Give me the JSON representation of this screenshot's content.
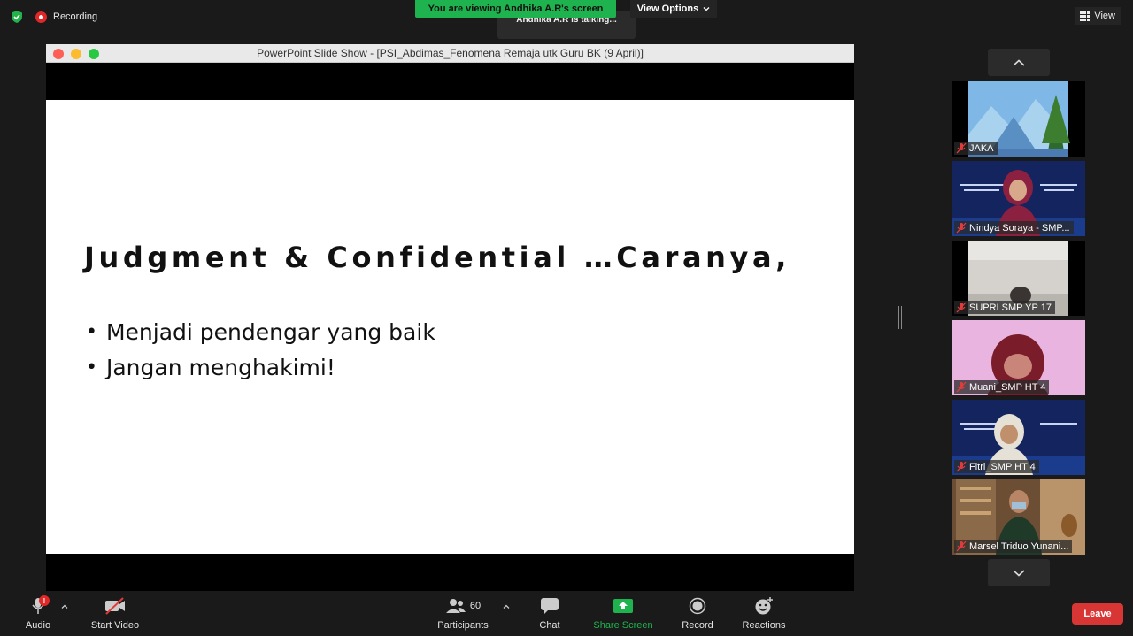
{
  "header": {
    "recording_label": "Recording",
    "viewing_banner": "You are viewing Andhika A.R's screen",
    "talking_indicator": "Andhika A.R is talking...",
    "view_options_label": "View Options",
    "view_label": "View"
  },
  "shared_window": {
    "title": "PowerPoint Slide Show  -  [PSI_Abdimas_Fenomena Remaja utk Guru BK (9 April)]",
    "slide": {
      "title": "Judgment & Confidential …Caranya,",
      "bullets": [
        "Menjadi pendengar yang baik",
        "Jangan menghakimi!"
      ]
    }
  },
  "gallery": {
    "participants": [
      {
        "name": "JAKA",
        "muted": true
      },
      {
        "name": "Nindya Soraya - SMP...",
        "muted": true
      },
      {
        "name": "SUPRI SMP YP 17",
        "muted": true
      },
      {
        "name": "Muani_SMP HT 4",
        "muted": true
      },
      {
        "name": "Fitri_SMP HT 4",
        "muted": true
      },
      {
        "name": "Marsel Triduo Yunani...",
        "muted": true
      }
    ]
  },
  "toolbar": {
    "audio_label": "Audio",
    "audio_badge": "!",
    "video_label": "Start Video",
    "participants_label": "Participants",
    "participants_count": "60",
    "chat_label": "Chat",
    "share_label": "Share Screen",
    "record_label": "Record",
    "reactions_label": "Reactions",
    "leave_label": "Leave"
  },
  "colors": {
    "accent_green": "#1fb34f",
    "leave_red": "#d83535",
    "recording_red": "#e02828"
  }
}
